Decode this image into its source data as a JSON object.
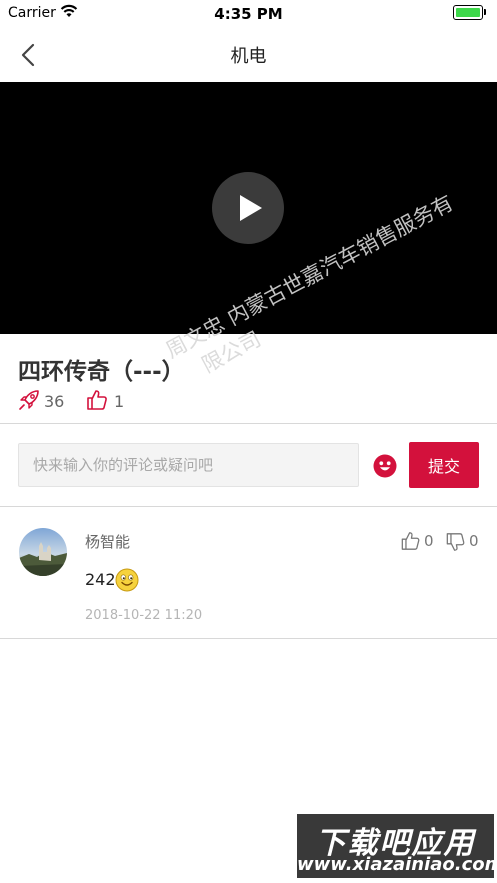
{
  "status_bar": {
    "carrier": "Carrier",
    "time": "4:35 PM"
  },
  "nav": {
    "title": "机电",
    "back_icon": "chevron-left-icon"
  },
  "video": {
    "play_icon": "play-icon",
    "background": "#000000"
  },
  "watermark": {
    "line1": "周文忠 内蒙古世嘉汽车销售服务有",
    "line2": "限公司"
  },
  "article": {
    "title": "四环传奇（---）",
    "views_icon": "rocket-icon",
    "views": "36",
    "likes_icon": "thumbs-up-icon",
    "likes": "1"
  },
  "comment_form": {
    "placeholder": "快来输入你的评论或疑问吧",
    "value": "",
    "emoji_icon": "emoji-face-icon",
    "submit_label": "提交",
    "accent_color": "#d3113c"
  },
  "comments": [
    {
      "name": "杨智能",
      "text": "242",
      "emoji": "smiley-icon",
      "time": "2018-10-22 11:20",
      "up_count": "0",
      "down_count": "0"
    }
  ],
  "corner_watermark": {
    "line1": "下载吧应用",
    "line2": "www.xiazainiao.com"
  }
}
